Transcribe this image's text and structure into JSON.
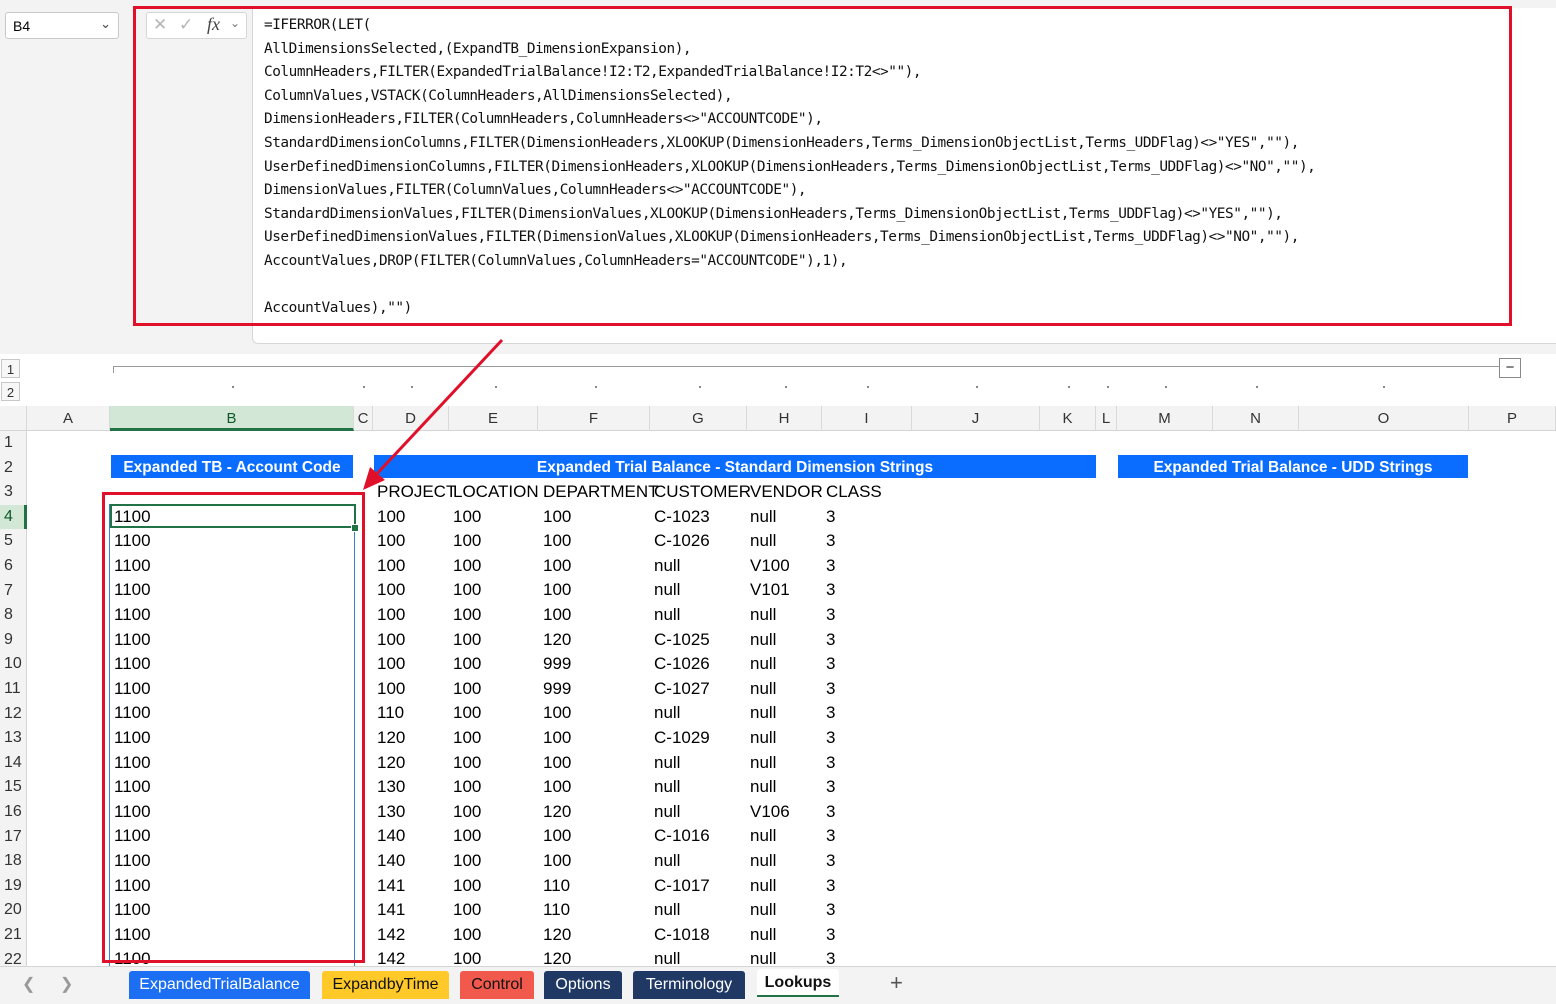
{
  "name_box": {
    "value": "B4"
  },
  "formula_bar": {
    "formula": "=IFERROR(LET(\nAllDimensionsSelected,(ExpandTB_DimensionExpansion),\nColumnHeaders,FILTER(ExpandedTrialBalance!I2:T2,ExpandedTrialBalance!I2:T2<>\"\"),\nColumnValues,VSTACK(ColumnHeaders,AllDimensionsSelected),\nDimensionHeaders,FILTER(ColumnHeaders,ColumnHeaders<>\"ACCOUNTCODE\"),\nStandardDimensionColumns,FILTER(DimensionHeaders,XLOOKUP(DimensionHeaders,Terms_DimensionObjectList,Terms_UDDFlag)<>\"YES\",\"\"),\nUserDefinedDimensionColumns,FILTER(DimensionHeaders,XLOOKUP(DimensionHeaders,Terms_DimensionObjectList,Terms_UDDFlag)<>\"NO\",\"\"),\nDimensionValues,FILTER(ColumnValues,ColumnHeaders<>\"ACCOUNTCODE\"),\nStandardDimensionValues,FILTER(DimensionValues,XLOOKUP(DimensionHeaders,Terms_DimensionObjectList,Terms_UDDFlag)<>\"YES\",\"\"),\nUserDefinedDimensionValues,FILTER(DimensionValues,XLOOKUP(DimensionHeaders,Terms_DimensionObjectList,Terms_UDDFlag)<>\"NO\",\"\"),\nAccountValues,DROP(FILTER(ColumnValues,ColumnHeaders=\"ACCOUNTCODE\"),1),\n\nAccountValues),\"\")"
  },
  "icons": {
    "cancel": "close-icon",
    "enter": "check-icon",
    "function": "fx-icon",
    "collapse": "minus-icon",
    "add_sheet": "plus-icon"
  },
  "outline": {
    "levels": [
      "1",
      "2"
    ],
    "collapse_label": "−"
  },
  "columns": [
    "A",
    "B",
    "C",
    "D",
    "E",
    "F",
    "G",
    "H",
    "I",
    "J",
    "K",
    "L",
    "M",
    "N",
    "O",
    "P"
  ],
  "rows": [
    "1",
    "2",
    "3",
    "4",
    "5",
    "6",
    "7",
    "8",
    "9",
    "10",
    "11",
    "12",
    "13",
    "14",
    "15",
    "16",
    "17",
    "18",
    "19",
    "20",
    "21",
    "22"
  ],
  "banners": {
    "account_code": "Expanded TB - Account Code",
    "standard_dimensions": "Expanded Trial Balance - Standard Dimension Strings",
    "udd_strings": "Expanded Trial Balance - UDD Strings"
  },
  "table": {
    "headers": [
      "PROJECT",
      "LOCATION",
      "DEPARTMENT",
      "CUSTOMER",
      "VENDOR",
      "CLASS"
    ],
    "account_codes": [
      "1100",
      "1100",
      "1100",
      "1100",
      "1100",
      "1100",
      "1100",
      "1100",
      "1100",
      "1100",
      "1100",
      "1100",
      "1100",
      "1100",
      "1100",
      "1100",
      "1100",
      "1100",
      "1100"
    ],
    "rows": [
      [
        "100",
        "100",
        "100",
        "C-1023",
        "null",
        "3"
      ],
      [
        "100",
        "100",
        "100",
        "C-1026",
        "null",
        "3"
      ],
      [
        "100",
        "100",
        "100",
        "null",
        "V100",
        "3"
      ],
      [
        "100",
        "100",
        "100",
        "null",
        "V101",
        "3"
      ],
      [
        "100",
        "100",
        "100",
        "null",
        "null",
        "3"
      ],
      [
        "100",
        "100",
        "120",
        "C-1025",
        "null",
        "3"
      ],
      [
        "100",
        "100",
        "999",
        "C-1026",
        "null",
        "3"
      ],
      [
        "100",
        "100",
        "999",
        "C-1027",
        "null",
        "3"
      ],
      [
        "110",
        "100",
        "100",
        "null",
        "null",
        "3"
      ],
      [
        "120",
        "100",
        "100",
        "C-1029",
        "null",
        "3"
      ],
      [
        "120",
        "100",
        "100",
        "null",
        "null",
        "3"
      ],
      [
        "130",
        "100",
        "100",
        "null",
        "null",
        "3"
      ],
      [
        "130",
        "100",
        "120",
        "null",
        "V106",
        "3"
      ],
      [
        "140",
        "100",
        "100",
        "C-1016",
        "null",
        "3"
      ],
      [
        "140",
        "100",
        "100",
        "null",
        "null",
        "3"
      ],
      [
        "141",
        "100",
        "110",
        "C-1017",
        "null",
        "3"
      ],
      [
        "141",
        "100",
        "110",
        "null",
        "null",
        "3"
      ],
      [
        "142",
        "100",
        "120",
        "C-1018",
        "null",
        "3"
      ],
      [
        "142",
        "100",
        "120",
        "null",
        "null",
        "3"
      ]
    ]
  },
  "sheet_tabs": [
    {
      "label": "ExpandedTrialBalance",
      "color": "#1c6ef2",
      "text_color": "#ffffff"
    },
    {
      "label": "ExpandbyTime",
      "color": "#ffc929",
      "text_color": "#111111"
    },
    {
      "label": "Control",
      "color": "#f0594c",
      "text_color": "#111111"
    },
    {
      "label": "Options",
      "color": "#1f3864",
      "text_color": "#ffffff"
    },
    {
      "label": "Terminology",
      "color": "#1f3864",
      "text_color": "#ffffff"
    },
    {
      "label": "Lookups",
      "color": "#e8e8e8",
      "text_color": "#111111",
      "active": true
    }
  ],
  "colors": {
    "banner": "#0a6dff",
    "highlight": "#e0102a",
    "selection": "#217346"
  }
}
